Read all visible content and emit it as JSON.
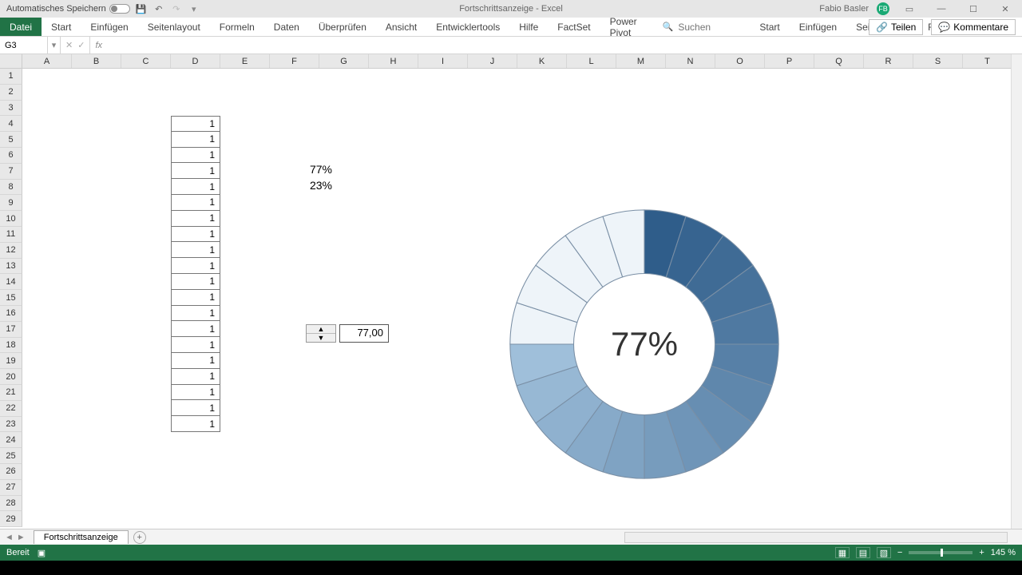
{
  "titlebar": {
    "autosave_label": "Automatisches Speichern",
    "doc_title": "Fortschrittsanzeige - Excel",
    "user_name": "Fabio Basler",
    "user_initials": "FB"
  },
  "tabs": {
    "file": "Datei",
    "items": [
      "Start",
      "Einfügen",
      "Seitenlayout",
      "Formeln",
      "Daten",
      "Überprüfen",
      "Ansicht",
      "Entwicklertools",
      "Hilfe",
      "FactSet",
      "Power Pivot"
    ],
    "search_placeholder": "Suchen",
    "share": "Teilen",
    "comments": "Kommentare"
  },
  "formula_bar": {
    "name_box": "G3",
    "formula": ""
  },
  "columns": [
    "A",
    "B",
    "C",
    "D",
    "E",
    "F",
    "G",
    "H",
    "I",
    "J",
    "K",
    "L",
    "M",
    "N",
    "O",
    "P",
    "Q",
    "R",
    "S",
    "T"
  ],
  "row_count": 29,
  "data_column": {
    "values": [
      "1",
      "1",
      "1",
      "1",
      "1",
      "1",
      "1",
      "1",
      "1",
      "1",
      "1",
      "1",
      "1",
      "1",
      "1",
      "1",
      "1",
      "1",
      "1",
      "1"
    ]
  },
  "percentages": {
    "p1": "77%",
    "p2": "23%"
  },
  "spinner": {
    "value": "77,00"
  },
  "chart_data": {
    "type": "pie",
    "title": "",
    "segments": 20,
    "filled_percent": 77,
    "center_label": "77%",
    "colors_filled_start": "#2f5d8a",
    "colors_filled_end": "#9fbfda",
    "color_empty": "#eef4f9"
  },
  "sheet": {
    "active": "Fortschrittsanzeige"
  },
  "status": {
    "ready": "Bereit",
    "zoom": "145 %"
  }
}
